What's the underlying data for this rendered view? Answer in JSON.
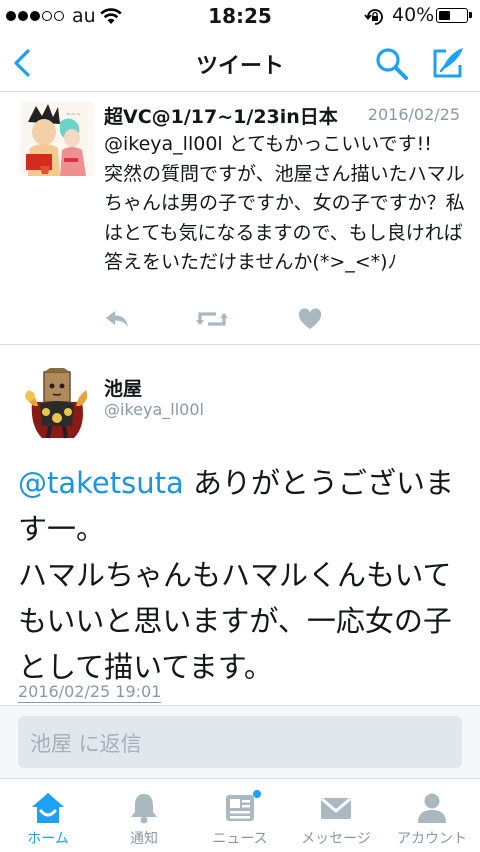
{
  "status_bar": {
    "carrier": "au",
    "time": "18:25",
    "battery": "40%"
  },
  "nav": {
    "title": "ツイート"
  },
  "reply_tweet": {
    "display_name": "超VC@1/17~1/23in日本",
    "date": "2016/02/25",
    "text": "@ikeya_ll00l とてもかっこいいです!!\n突然の質問ですが、池屋さん描いたハマルちゃんは男の子ですか、女の子ですか？私はとても気になるますので、もし良ければ答えをいただけませんか(*>_<*)ﾉ"
  },
  "main_tweet": {
    "display_name": "池屋",
    "handle": "@ikeya_ll00l",
    "mention": "@taketsuta",
    "text_line1": " ありがとうございます一。",
    "text_para2": "ハマルちゃんもハマルくんもいてもいいと思いますが、一応女の子として描いてます。",
    "timestamp": "2016/02/25 19:01"
  },
  "reply_box": {
    "placeholder": "池屋 に返信"
  },
  "tabs": [
    {
      "label": "ホーム",
      "icon": "home-icon",
      "active": true
    },
    {
      "label": "通知",
      "icon": "bell-icon",
      "active": false
    },
    {
      "label": "ニュース",
      "icon": "news-icon",
      "active": false
    },
    {
      "label": "メッセージ",
      "icon": "envelope-icon",
      "active": false
    },
    {
      "label": "アカウント",
      "icon": "person-icon",
      "active": false
    }
  ],
  "colors": {
    "accent": "#1da1f2",
    "secondary_text": "#8899a6",
    "icon_gray": "#aab8c2"
  }
}
